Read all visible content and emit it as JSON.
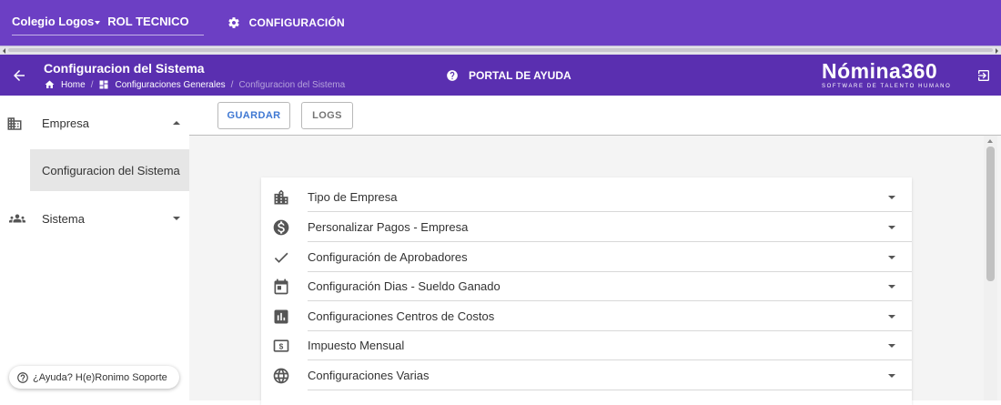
{
  "topbar": {
    "company_name": "Colegio Logos",
    "role": "ROL TECNICO",
    "config_label": "CONFIGURACIÓN",
    "bg_color": "#6c3fc4"
  },
  "header": {
    "title": "Configuracion del Sistema",
    "breadcrumb": {
      "home": "Home",
      "general": "Configuraciones Generales",
      "current": "Configuracion del Sistema"
    },
    "help_portal": "PORTAL DE AYUDA",
    "brand_name": "Nómina360",
    "brand_tagline": "SOFTWARE DE TALENTO HUMANO",
    "bg_color": "#5a2fb0"
  },
  "sidebar": {
    "groups": [
      {
        "label": "Empresa",
        "icon": "building-icon",
        "expanded": true
      },
      {
        "label": "Sistema",
        "icon": "group-icon",
        "expanded": false
      }
    ],
    "sub_item": "Configuracion del Sistema",
    "help_chip": "¿Ayuda? H(e)Ronimo Soporte"
  },
  "toolbar": {
    "save_label": "GUARDAR",
    "logs_label": "LOGS"
  },
  "sections": [
    {
      "label": "Tipo de Empresa",
      "icon": "building-icon"
    },
    {
      "label": "Personalizar Pagos - Empresa",
      "icon": "dollar-circle-icon"
    },
    {
      "label": "Configuración de Aprobadores",
      "icon": "check-icon"
    },
    {
      "label": "Configuración Dias - Sueldo Ganado",
      "icon": "calendar-icon"
    },
    {
      "label": "Configuraciones Centros de Costos",
      "icon": "bar-chart-icon"
    },
    {
      "label": "Impuesto Mensual",
      "icon": "money-icon"
    },
    {
      "label": "Configuraciones Varias",
      "icon": "globe-icon"
    }
  ]
}
